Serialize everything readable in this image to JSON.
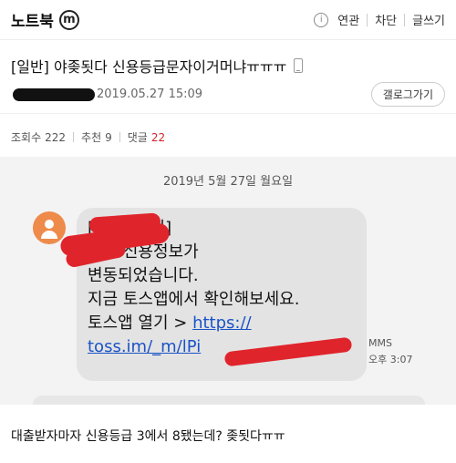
{
  "header": {
    "gallery_name": "노트북",
    "mini_badge": "ⓜ",
    "info_icon": "i",
    "actions": [
      "연관",
      "차단",
      "글쓰기"
    ]
  },
  "post": {
    "title": "[일반] 야좆됫다 신용등급문자이거머냐ㅠㅠㅠ",
    "date": "2019.05.27 15:09",
    "gallery_button": "갤로그가기",
    "stats": {
      "views_label": "조회수",
      "views": "222",
      "recommend_label": "추천",
      "recommend": "9",
      "replies_label": "댓글",
      "replies": "22"
    }
  },
  "sms": {
    "date_header": "2019년 5월 27일 월요일",
    "lines": [
      "[Web 발신]",
      "   님의 신용정보가",
      "변동되었습니다.",
      "지금 토스앱에서 확인해보세요.",
      "토스앱 열기 >"
    ],
    "link_part1": "https://",
    "link_part2": "toss.im/_m/lPi",
    "type": "MMS",
    "time": "오후 3:07",
    "redaction_color": "#e0242c",
    "avatar_color": "#ee8a4a"
  },
  "body_text": "대출받자마자 신용등급 3에서 8됐는데? 좆됫다ㅠㅠ",
  "colors": {
    "reply_count": "#d2232a",
    "link": "#1a53c7"
  }
}
